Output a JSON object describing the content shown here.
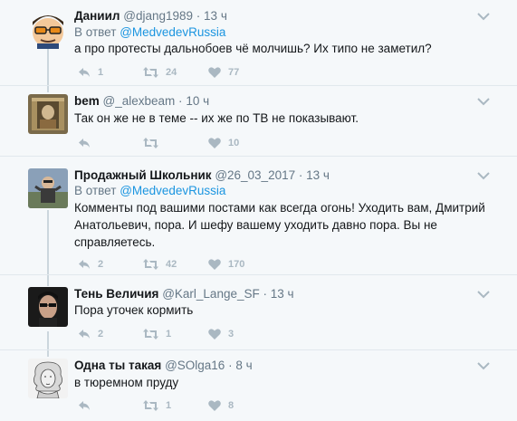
{
  "tweets": [
    {
      "name": "Даниил",
      "handle": "@djang1989",
      "dot": "·",
      "time": "13 ч",
      "reply_prefix": "В ответ",
      "reply_mention": "@MedvedevRussia",
      "text": "а про протесты дальнобоев чё молчишь? Их типо не заметил?",
      "replies": "1",
      "retweets": "24",
      "likes": "77"
    },
    {
      "name": "bem",
      "handle": "@_alexbeam",
      "dot": "·",
      "time": "10 ч",
      "text": "Так он же не в теме -- их же по ТВ не показывают.",
      "replies": "",
      "retweets": "",
      "likes": "10"
    },
    {
      "name": "Продажный Школьник",
      "handle": "@26_03_2017",
      "dot": "·",
      "time": "13 ч",
      "reply_prefix": "В ответ",
      "reply_mention": "@MedvedevRussia",
      "text": "Комменты под вашими постами как всегда огонь! Уходить вам, Дмитрий Анатольевич, пора. И шефу вашему уходить давно пора. Вы не справляетесь.",
      "replies": "2",
      "retweets": "42",
      "likes": "170"
    },
    {
      "name": "Тень Величия",
      "handle": "@Karl_Lange_SF",
      "dot": "·",
      "time": "13 ч",
      "text": "Пора уточек кормить",
      "replies": "2",
      "retweets": "1",
      "likes": "3"
    },
    {
      "name": "Одна ты такая",
      "handle": "@SOlga16",
      "dot": "·",
      "time": "8 ч",
      "text": "в тюремном пруду",
      "replies": "",
      "retweets": "1",
      "likes": "8"
    }
  ],
  "icons": {
    "reply": "reply-icon",
    "retweet": "retweet-icon",
    "like": "heart-icon",
    "more": "chevron-down-icon"
  },
  "colors": {
    "mention": "#1b95e0",
    "muted": "#657786",
    "action": "#aab8c2",
    "thread_line": "#ccd6dd"
  }
}
